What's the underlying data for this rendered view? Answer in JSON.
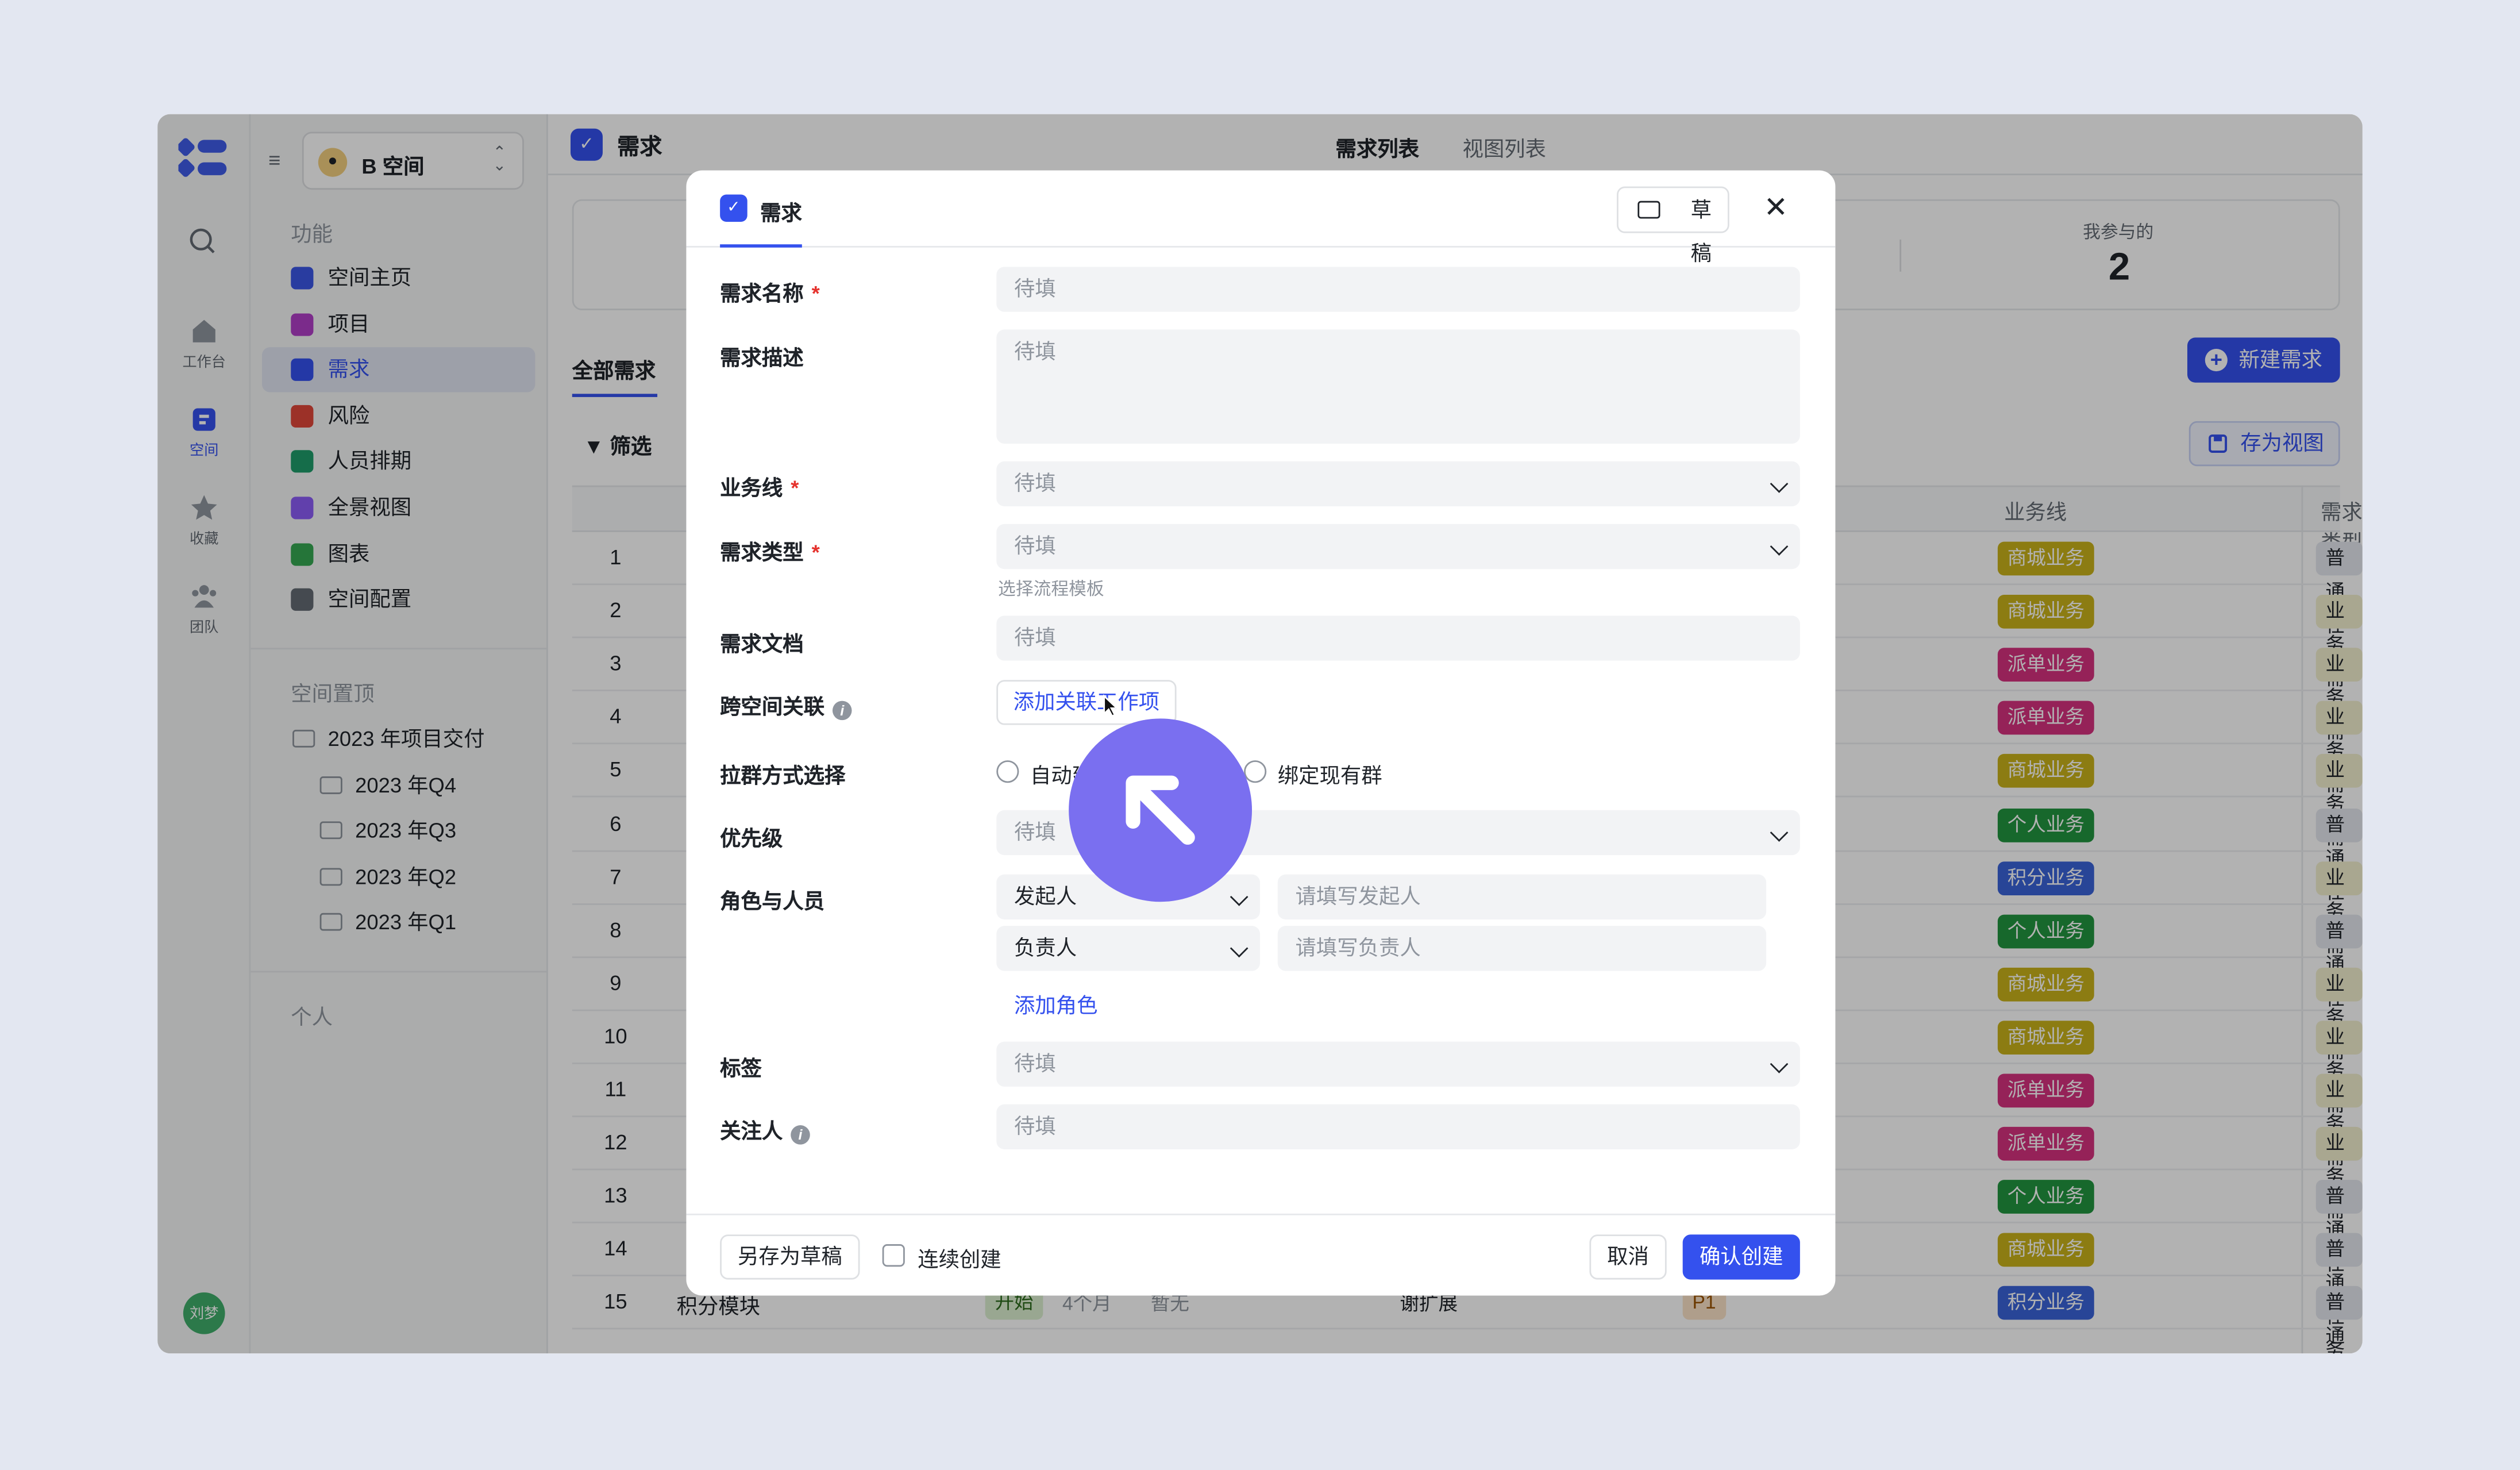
{
  "rail": {
    "items": [
      {
        "label": "工作台",
        "icon": "home-icon"
      },
      {
        "label": "空间",
        "icon": "space-icon",
        "active": true
      },
      {
        "label": "收藏",
        "icon": "star-icon"
      },
      {
        "label": "团队",
        "icon": "team-icon"
      }
    ],
    "avatar": "刘梦"
  },
  "sidebar": {
    "space_name": "B 空间",
    "section_features": "功能",
    "items": [
      {
        "label": "空间主页",
        "color": "#3b57e6"
      },
      {
        "label": "项目",
        "color": "#b13ec8"
      },
      {
        "label": "需求",
        "color": "#3451ee",
        "active": true
      },
      {
        "label": "风险",
        "color": "#e0473a"
      },
      {
        "label": "人员排期",
        "color": "#1f9d6b"
      },
      {
        "label": "全景视图",
        "color": "#8b5cf6"
      },
      {
        "label": "图表",
        "color": "#36a852"
      },
      {
        "label": "空间配置",
        "color": "#646a73"
      }
    ],
    "section_pinned": "空间置顶",
    "folders": [
      "2023 年项目交付",
      "2023 年Q4",
      "2023 年Q3",
      "2023 年Q2",
      "2023 年Q1"
    ],
    "section_personal": "个人"
  },
  "main": {
    "title": "需求",
    "tabs": [
      "需求列表",
      "视图列表"
    ],
    "stat_label": "我参与的",
    "stat_value": "2",
    "all_tab": "全部需求",
    "new_button": "新建需求",
    "filter": "筛选",
    "save_view": "存为视图",
    "columns": {
      "business_line": "业务线",
      "req_type": "需求类型"
    },
    "rows": [
      {
        "n": "1",
        "bl": "商城业务",
        "type": "普通任务"
      },
      {
        "n": "2",
        "bl": "商城业务",
        "type": "业务需求"
      },
      {
        "n": "3",
        "bl": "派单业务",
        "type": "业务需求"
      },
      {
        "n": "4",
        "bl": "派单业务",
        "type": "业务需求"
      },
      {
        "n": "5",
        "bl": "商城业务",
        "type": "业务需求"
      },
      {
        "n": "6",
        "bl": "个人业务",
        "type": "普通任务"
      },
      {
        "n": "7",
        "bl": "积分业务",
        "type": "业务需求"
      },
      {
        "n": "8",
        "bl": "个人业务",
        "type": "普通任务"
      },
      {
        "n": "9",
        "bl": "商城业务",
        "type": "业务需求"
      },
      {
        "n": "10",
        "bl": "商城业务",
        "type": "业务需求"
      },
      {
        "n": "11",
        "bl": "派单业务",
        "type": "业务需求"
      },
      {
        "n": "12",
        "bl": "派单业务",
        "type": "业务需求"
      },
      {
        "n": "13",
        "bl": "个人业务",
        "type": "普通任务"
      },
      {
        "n": "14",
        "bl": "商城业务",
        "type": "普通任务"
      },
      {
        "n": "15",
        "bl": "积分业务",
        "type": "普通任务"
      }
    ],
    "row15": {
      "name": "积分模块",
      "status": "开始",
      "duration": "4个月",
      "empty": "暂无",
      "person": "谢扩展",
      "priority": "P1"
    },
    "tag_colors": {
      "商城业务": "#c9b21a",
      "派单业务": "#d6317f",
      "个人业务": "#22963f",
      "积分业务": "#3a63d8"
    }
  },
  "modal": {
    "title": "需求",
    "draft": "草稿",
    "fields": {
      "name": {
        "label": "需求名称",
        "placeholder": "待填"
      },
      "desc": {
        "label": "需求描述",
        "placeholder": "待填"
      },
      "business_line": {
        "label": "业务线",
        "placeholder": "待填"
      },
      "req_type": {
        "label": "需求类型",
        "placeholder": "待填",
        "hint": "选择流程模板"
      },
      "doc": {
        "label": "需求文档",
        "placeholder": "待填"
      },
      "cross_space": {
        "label": "跨空间关联",
        "button": "添加关联工作项"
      },
      "group": {
        "label": "拉群方式选择",
        "option1": "自动建群",
        "option2": "绑定现有群"
      },
      "priority": {
        "label": "优先级",
        "placeholder": "待填"
      },
      "roles": {
        "label": "角色与人员",
        "role1": "发起人",
        "role1_placeholder": "请填写发起人",
        "role2": "负责人",
        "role2_placeholder": "请填写负责人",
        "add": "添加角色"
      },
      "tags": {
        "label": "标签",
        "placeholder": "待填"
      },
      "watchers": {
        "label": "关注人",
        "placeholder": "待填"
      }
    },
    "footer": {
      "save_draft": "另存为草稿",
      "continuous": "连续创建",
      "cancel": "取消",
      "confirm": "确认创建"
    }
  }
}
